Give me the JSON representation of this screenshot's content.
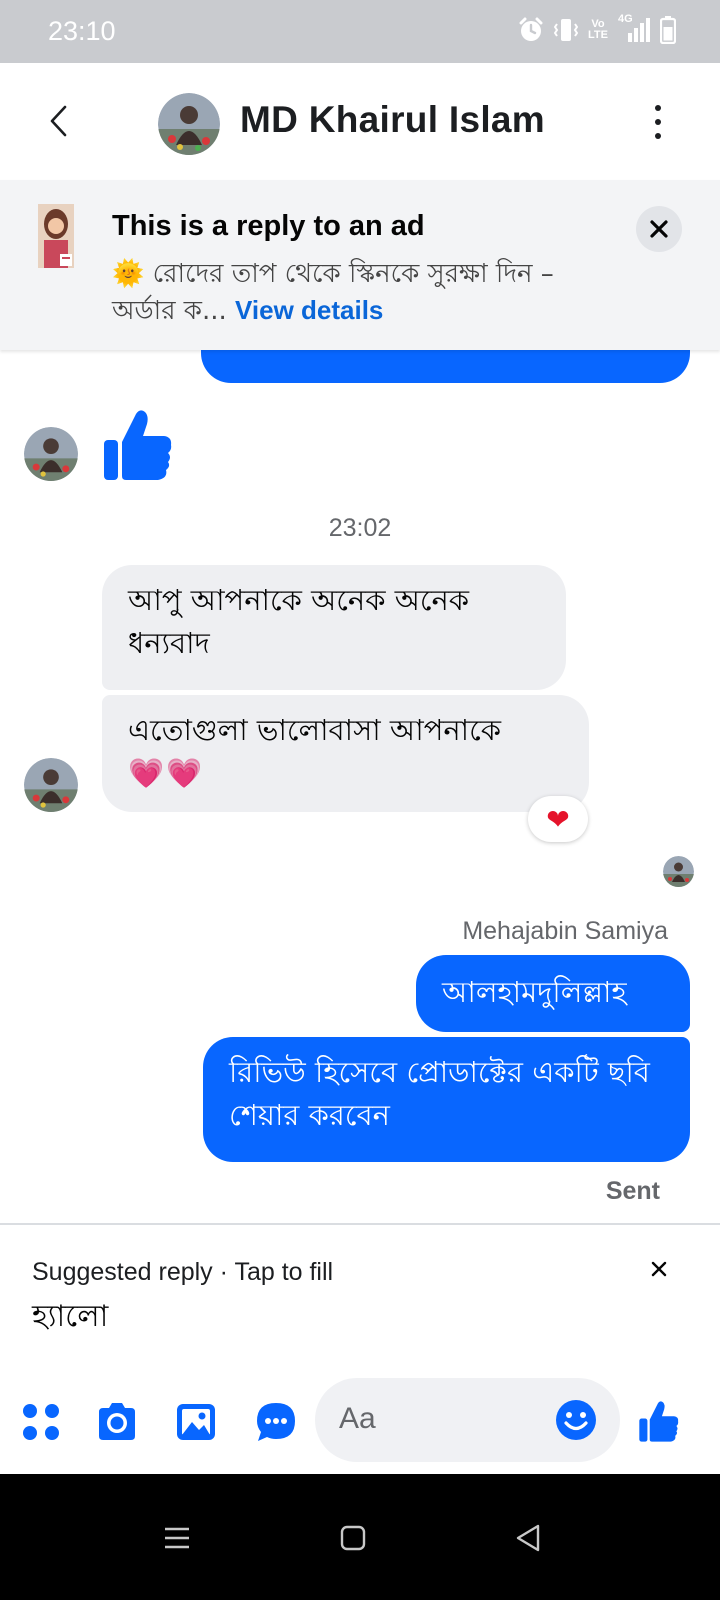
{
  "status_bar": {
    "time": "23:10",
    "volte": "Vo LTE",
    "network": "4G"
  },
  "header": {
    "contact_name": "MD Khairul Islam"
  },
  "ad": {
    "title": "This is a reply to an ad",
    "sun_emoji": "🌞",
    "text": "রোদের তাপ থেকে স্কিনকে সুরক্ষা দিন – অর্ডার ক...",
    "link": "View details"
  },
  "messages": {
    "timestamp": "23:02",
    "received_1": "আপু আপনাকে অনেক অনেক ধন্যবাদ",
    "received_2": "এতোগুলা ভালোবাসা আপনাকে",
    "received_2_emoji": "💗💗",
    "reaction": "❤",
    "sender_name": "Mehajabin Samiya",
    "sent_1": "আলহামদুলিল্লাহ",
    "sent_2": "রিভিউ হিসেবে প্রোডাক্টের একটি ছবি শেয়ার করবেন",
    "status": "Sent"
  },
  "suggested_reply": {
    "label": "Suggested reply · Tap to fill",
    "text": "হ্যালো"
  },
  "composer": {
    "placeholder": "Aa"
  },
  "colors": {
    "accent": "#0866ff",
    "bubble_grey": "#eeeff2",
    "status_bar": "#c9cbcf"
  }
}
